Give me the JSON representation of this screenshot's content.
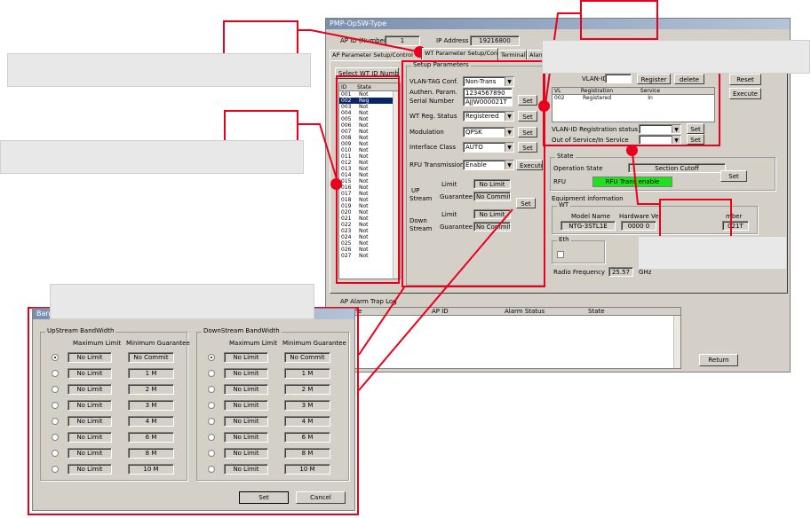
{
  "main_window": {
    "title": "PMP-OpSW-Type",
    "ap_id_label": "AP ID (Number)",
    "ap_id_value": "1",
    "ip_label": "IP Address",
    "ip_value": "19216800"
  },
  "tabs": [
    {
      "label": "AP Parameter Setup/Control"
    },
    {
      "label": "WT Parameter Setup/Control"
    },
    {
      "label": "Terminal"
    },
    {
      "label": "Alarm"
    }
  ],
  "wt_list": {
    "select_button": "Select WT ID Number",
    "col_id": "ID",
    "col_state": "State",
    "rows": [
      {
        "id": "001",
        "state": "Not"
      },
      {
        "id": "002",
        "state": "Reg"
      },
      {
        "id": "003",
        "state": "Not"
      },
      {
        "id": "004",
        "state": "Not"
      },
      {
        "id": "005",
        "state": "Not"
      },
      {
        "id": "006",
        "state": "Not"
      },
      {
        "id": "007",
        "state": "Not"
      },
      {
        "id": "008",
        "state": "Not"
      },
      {
        "id": "009",
        "state": "Not"
      },
      {
        "id": "010",
        "state": "Not"
      },
      {
        "id": "011",
        "state": "Not"
      },
      {
        "id": "012",
        "state": "Not"
      },
      {
        "id": "013",
        "state": "Not"
      },
      {
        "id": "014",
        "state": "Not"
      },
      {
        "id": "015",
        "state": "Not"
      },
      {
        "id": "016",
        "state": "Not"
      },
      {
        "id": "017",
        "state": "Not"
      },
      {
        "id": "018",
        "state": "Not"
      },
      {
        "id": "019",
        "state": "Not"
      },
      {
        "id": "020",
        "state": "Not"
      },
      {
        "id": "021",
        "state": "Not"
      },
      {
        "id": "022",
        "state": "Not"
      },
      {
        "id": "023",
        "state": "Not"
      },
      {
        "id": "024",
        "state": "Not"
      },
      {
        "id": "025",
        "state": "Not"
      },
      {
        "id": "026",
        "state": "Not"
      },
      {
        "id": "027",
        "state": "Not"
      }
    ]
  },
  "setup": {
    "title": "Setup Parameters",
    "vlan_tag_label": "VLAN-TAG Conf.",
    "vlan_tag_value": "Non-Trans",
    "authen_label": "Authen. Param.",
    "authen_value": "1234567890",
    "serial_label": "Serial Number",
    "serial_value": "AJJW000021T",
    "wt_reg_label": "WT Reg. Status",
    "wt_reg_value": "Registered",
    "modulation_label": "Modulation",
    "modulation_value": "QPSK",
    "iface_label": "Interface Class",
    "iface_value": "AUTO",
    "rfu_label": "RFU Transmission",
    "rfu_value": "Enable",
    "set": "Set",
    "execute": "Execute",
    "limit_label": "Limit",
    "guarantee_label": "Guarantee",
    "up_label": "UP",
    "stream_label": "Stream",
    "down_label": "Down",
    "up_limit": "No Limit",
    "up_guarantee": "No Commit",
    "down_limit": "No Limit",
    "down_guarantee": "No Commit"
  },
  "vlan": {
    "vlan_id_label": "VLAN-ID",
    "register": "Register",
    "delete": "delete",
    "col_vl": "VL",
    "col_registration": "Registration",
    "col_service": "Service",
    "row_vl": "002",
    "row_registration": "Registered",
    "row_service": "In",
    "reg_status_label": "VLAN-ID Registration status",
    "service_label": "Out of Service/In Service",
    "set": "Set"
  },
  "right_buttons": {
    "reset": "Reset",
    "execute": "Execute"
  },
  "state": {
    "title": "State",
    "op_state_label": "Operation State",
    "op_state_value": "Section Cutoff",
    "rfu_label": "RFU",
    "rfu_value": "RFU Trans enable",
    "set": "Set"
  },
  "equipment": {
    "title": "Equipment information",
    "wt_label": "WT",
    "model_col": "Model Name",
    "hw_col": "Hardware Ve",
    "num_col": "mber",
    "model_value": "NTG-3STL1E",
    "hw_value": "0000 0",
    "num_value": "021T",
    "eth_label": "Eth",
    "radio_label": "Radio Frequency",
    "radio_value": "25.57",
    "radio_unit": "GHz"
  },
  "alarm_log": {
    "title": "AP Alarm Trap Log",
    "col_name": "ame",
    "col_apid": "AP ID",
    "col_status": "Alarm Status",
    "col_state": "State",
    "return": "Return"
  },
  "bandwidth_dialog": {
    "title": "Band",
    "upstream_title": "UpStream BandWidth",
    "downstream_title": "DownStream BandWidth",
    "max_label": "Maximum Limit",
    "min_label": "Minimum Guarantee",
    "rows": [
      {
        "limit": "No Limit",
        "guarantee": "No Commit"
      },
      {
        "limit": "No Limit",
        "guarantee": "1 M"
      },
      {
        "limit": "No Limit",
        "guarantee": "2 M"
      },
      {
        "limit": "No Limit",
        "guarantee": "3 M"
      },
      {
        "limit": "No Limit",
        "guarantee": "4 M"
      },
      {
        "limit": "No Limit",
        "guarantee": "6 M"
      },
      {
        "limit": "No Limit",
        "guarantee": "8 M"
      },
      {
        "limit": "No Limit",
        "guarantee": "10 M"
      }
    ],
    "selected_up": 0,
    "selected_down": 0,
    "set": "Set",
    "cancel": "Cancel"
  },
  "colors": {
    "annotation": "#e8001c",
    "callout": "#e8e8e8",
    "window": "#d4d0c8",
    "selection": "#0a246a",
    "led": "#20e020"
  }
}
